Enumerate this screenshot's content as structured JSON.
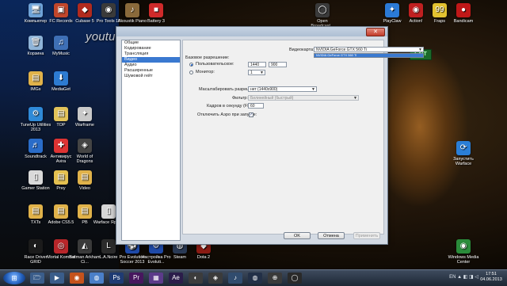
{
  "watermark": "youtube.com/user/HomicideUnitWF",
  "scene": {
    "exit_sign": "EXIT"
  },
  "desktop_icons": [
    {
      "label": "Компьютер",
      "color": "#6fa3d8",
      "glyph": "🖥"
    },
    {
      "label": "FC Records",
      "color": "#c0462b",
      "glyph": "▣"
    },
    {
      "label": "Cubase 5",
      "color": "#b12a1e",
      "glyph": "◆"
    },
    {
      "label": "Pro Tools 10",
      "color": "#3a3a3a",
      "glyph": "◉"
    },
    {
      "label": "Akoustik Piano",
      "color": "#8a6a3b",
      "glyph": "♪"
    },
    {
      "label": "Battery 3",
      "color": "#cf2a2a",
      "glyph": "■"
    },
    {
      "label": "Корзина",
      "color": "#8fb4d8",
      "glyph": "🗑"
    },
    {
      "label": "MyMusic",
      "color": "#3e6fb5",
      "glyph": "♫"
    },
    {
      "label": "IMGs",
      "color": "#e0b24a",
      "glyph": "▤"
    },
    {
      "label": "MediaGet",
      "color": "#2d7bd1",
      "glyph": "⬇"
    },
    {
      "label": "TuneUp Utilities 2013",
      "color": "#2f8ad8",
      "glyph": "⚙"
    },
    {
      "label": "TOP",
      "color": "#e2c35a",
      "glyph": "▤"
    },
    {
      "label": "Warframe",
      "color": "#c9c9c9",
      "glyph": "✦"
    },
    {
      "label": "Soundtrack",
      "color": "#2a6cc8",
      "glyph": "♬"
    },
    {
      "label": "Антивирус Avira",
      "color": "#d33",
      "glyph": "✚"
    },
    {
      "label": "World of Dragons",
      "color": "#444",
      "glyph": "◈"
    },
    {
      "label": "Gamer Station",
      "color": "#d9d9d9",
      "glyph": "▯"
    },
    {
      "label": "Prey",
      "color": "#e4c050",
      "glyph": "▤"
    },
    {
      "label": "Video",
      "color": "#e0b24a",
      "glyph": "▤"
    },
    {
      "label": "TXTs",
      "color": "#e0b24a",
      "glyph": "▤"
    },
    {
      "label": "Adobe CS5.5",
      "color": "#e0b24a",
      "glyph": "▤"
    },
    {
      "label": "PB",
      "color": "#e0b24a",
      "glyph": "▤"
    },
    {
      "label": "Warface Ярлык",
      "color": "#d6d6d6",
      "glyph": "▯"
    },
    {
      "label": "Race Driver GRID",
      "color": "#1b1b1b",
      "glyph": "◐"
    },
    {
      "label": "Mortal Kombat",
      "color": "#b8262a",
      "glyph": "◎"
    },
    {
      "label": "Batman Arkham Ci...",
      "color": "#3a3a3a",
      "glyph": "◭"
    },
    {
      "label": "L.A.Noire",
      "color": "#2b2b2b",
      "glyph": "L"
    },
    {
      "label": "Pro Evolution Soccer 2013",
      "color": "#1f4aa8",
      "glyph": "⚽"
    },
    {
      "label": "Настройка Pro Evoluti...",
      "color": "#1f4aa8",
      "glyph": "⚙"
    },
    {
      "label": "Steam",
      "color": "#2a3a55",
      "glyph": "◍"
    },
    {
      "label": "Dota 2",
      "color": "#8a1b13",
      "glyph": "◆"
    },
    {
      "label": "Open Broadcast...",
      "color": "#3a3a3a",
      "glyph": "◯"
    },
    {
      "label": "PlayClaw",
      "color": "#2b7ad6",
      "glyph": "✦"
    },
    {
      "label": "Action!",
      "color": "#c02020",
      "glyph": "◉"
    },
    {
      "label": "Fraps",
      "color": "#e3c230",
      "glyph": "99"
    },
    {
      "label": "Bandicam",
      "color": "#c01818",
      "glyph": "●"
    },
    {
      "label": "Запустить Warface",
      "color": "#2a7ed6",
      "glyph": "⟳"
    },
    {
      "label": "Windows Media Center",
      "color": "#2a8b3a",
      "glyph": "◉"
    }
  ],
  "dialog": {
    "close_label": "✕",
    "sidebar": [
      "Общие",
      "Кодирование",
      "Трансляция",
      "Видео",
      "Аудио",
      "Расширенные",
      "Шумовой гейт"
    ],
    "selected_index": 3,
    "video": {
      "videocard_label": "Видеокарта:",
      "videocard_value": "NVIDIA GeForce GTX 560 Ti",
      "dropdown_option": "NVIDIA GeForce GTX 560 Ti",
      "base_res_label": "Базовое разрешение:",
      "custom_label": "Пользовательское:",
      "width": "1440",
      "height": "900",
      "monitor_label": "Монитор:",
      "monitor_value": "1",
      "scale_label": "Масштабировать разрешение:",
      "scale_value": "нет (1440x900)",
      "filter_label": "Фильтр:",
      "filter_value": "Билинейный (быстрый)",
      "fps_label": "Кадров в секунду (FPS):",
      "fps_value": "60",
      "aero_label": "Отключить Аэро при запуске:",
      "aero_checked": "✓"
    },
    "buttons": {
      "ok": "OK",
      "cancel": "Отмена",
      "apply": "Применить"
    }
  },
  "taskbar": {
    "start_glyph": "⊞",
    "apps": [
      {
        "glyph": "🗁",
        "color": "#3a5d8a"
      },
      {
        "glyph": "▶",
        "color": "#3a5d8a"
      },
      {
        "glyph": "◉",
        "color": "#c5531c"
      },
      {
        "glyph": "◍",
        "color": "#4a7fc8"
      },
      {
        "glyph": "Ps",
        "color": "#1f3b73"
      },
      {
        "glyph": "Pr",
        "color": "#47175e"
      },
      {
        "glyph": "▦",
        "color": "#5c3b8a"
      },
      {
        "glyph": "Ae",
        "color": "#2b1d4a"
      },
      {
        "glyph": "◐",
        "color": "#3c3c3c"
      },
      {
        "glyph": "◈",
        "color": "#3b3b3b"
      },
      {
        "glyph": "♪",
        "color": "#314c6e"
      },
      {
        "glyph": "◍",
        "color": "#233047"
      },
      {
        "glyph": "⊕",
        "color": "#3a3a3a"
      },
      {
        "glyph": "◯",
        "color": "#2a2a2a"
      }
    ],
    "tray": "EN ▲ ◧ ◨ ◁",
    "time": "17:51",
    "date": "04.06.2013"
  }
}
